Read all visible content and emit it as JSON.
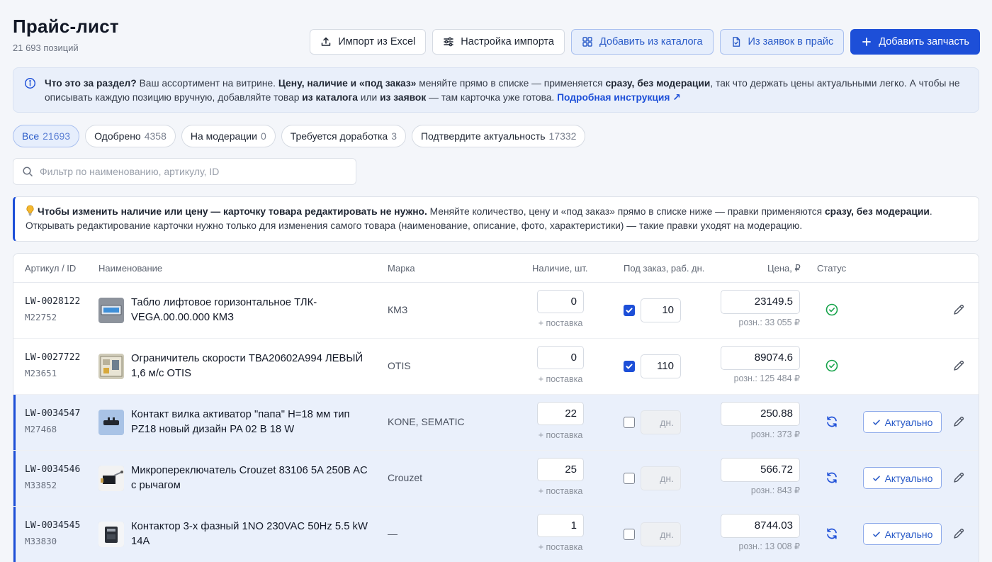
{
  "header": {
    "title": "Прайс-лист",
    "subtitle": "21 693 позиций"
  },
  "toolbar": {
    "import_excel": "Импорт из Excel",
    "import_settings": "Настройка импорта",
    "add_from_catalog": "Добавить из каталога",
    "from_requests": "Из заявок в прайс",
    "add_part": "Добавить запчасть"
  },
  "info": {
    "t1": "Что это за раздел?",
    "t2": " Ваш ассортимент на витрине. ",
    "t3": "Цену, наличие и «под заказ»",
    "t4": " меняйте прямо в списке — применяется ",
    "t5": "сразу, без модерации",
    "t6": ", так что держать цены актуальными легко. А чтобы не описывать каждую позицию вручную, добавляйте товар ",
    "t7": "из каталога",
    "t8": " или ",
    "t9": "из заявок",
    "t10": " — там карточка уже готова. ",
    "link": "Подробная инструкция ↗"
  },
  "filters": [
    {
      "label": "Все",
      "count": "21693"
    },
    {
      "label": "Одобрено",
      "count": "4358"
    },
    {
      "label": "На модерации",
      "count": "0"
    },
    {
      "label": "Требуется доработка",
      "count": "3"
    },
    {
      "label": "Подтвердите актуальность",
      "count": "17332"
    }
  ],
  "search": {
    "placeholder": "Фильтр по наименованию, артикулу, ID"
  },
  "tip": {
    "t1": "Чтобы изменить наличие или цену — карточку товара редактировать не нужно.",
    "t2": " Меняйте количество, цену и «под заказ» прямо в списке ниже — правки применяются ",
    "t3": "сразу, без модерации",
    "t4": ".",
    "t5": "Открывать редактирование карточки нужно только для изменения самого товара (наименование, описание, фото, характеристики) — такие правки уходят на модерацию."
  },
  "table": {
    "headers": {
      "sku": "Артикул / ID",
      "name": "Наименование",
      "brand": "Марка",
      "stock": "Наличие, шт.",
      "order": "Под заказ, раб. дн.",
      "price": "Цена, ₽",
      "status": "Статус"
    },
    "supply_label": "+ поставка",
    "days_placeholder": "дн.",
    "actual_label": "Актуально",
    "rows": [
      {
        "sku": "LW-0028122",
        "id": "M22752",
        "name": "Табло лифтовое горизонтальное ТЛК-VEGA.00.00.000 КМЗ",
        "brand": "КМЗ",
        "stock": "0",
        "order_checked": true,
        "days": "10",
        "price": "23149.5",
        "retail": "розн.: 33 055 ₽",
        "status": "approved"
      },
      {
        "sku": "LW-0027722",
        "id": "M23651",
        "name": "Ограничитель скорости ТВА20602А994 ЛЕВЫЙ 1,6 м/с OTIS",
        "brand": "OTIS",
        "stock": "0",
        "order_checked": true,
        "days": "110",
        "price": "89074.6",
        "retail": "розн.: 125 484 ₽",
        "status": "approved"
      },
      {
        "sku": "LW-0034547",
        "id": "M27468",
        "name": "Контакт вилка активатор \"папа\" H=18 мм тип PZ18 новый дизайн PA 02 B 18 W",
        "brand": "KONE, SEMATIC",
        "stock": "22",
        "order_checked": false,
        "days": "",
        "price": "250.88",
        "retail": "розн.: 373 ₽",
        "status": "confirm"
      },
      {
        "sku": "LW-0034546",
        "id": "M33852",
        "name": "Микропереключатель Crouzet 83106 5A 250B AC с рычагом",
        "brand": "Crouzet",
        "stock": "25",
        "order_checked": false,
        "days": "",
        "price": "566.72",
        "retail": "розн.: 843 ₽",
        "status": "confirm"
      },
      {
        "sku": "LW-0034545",
        "id": "M33830",
        "name": "Контактор 3-х фазный 1NO 230VAC 50Hz 5.5 kW 14A",
        "brand": "—",
        "stock": "1",
        "order_checked": false,
        "days": "",
        "price": "8744.03",
        "retail": "розн.: 13 008 ₽",
        "status": "confirm"
      }
    ]
  },
  "colors": {
    "accent": "#1d4fd8",
    "approved": "#16a34a",
    "highlight_row": "#eaf0fb"
  },
  "icons": {
    "import_excel": "upload-icon",
    "import_settings": "sliders-icon",
    "add_from_catalog": "grid-icon",
    "from_requests": "document-icon",
    "add_part": "plus-icon",
    "approved": "check-circle-icon",
    "confirm": "refresh-icon",
    "edit": "pencil-icon"
  }
}
